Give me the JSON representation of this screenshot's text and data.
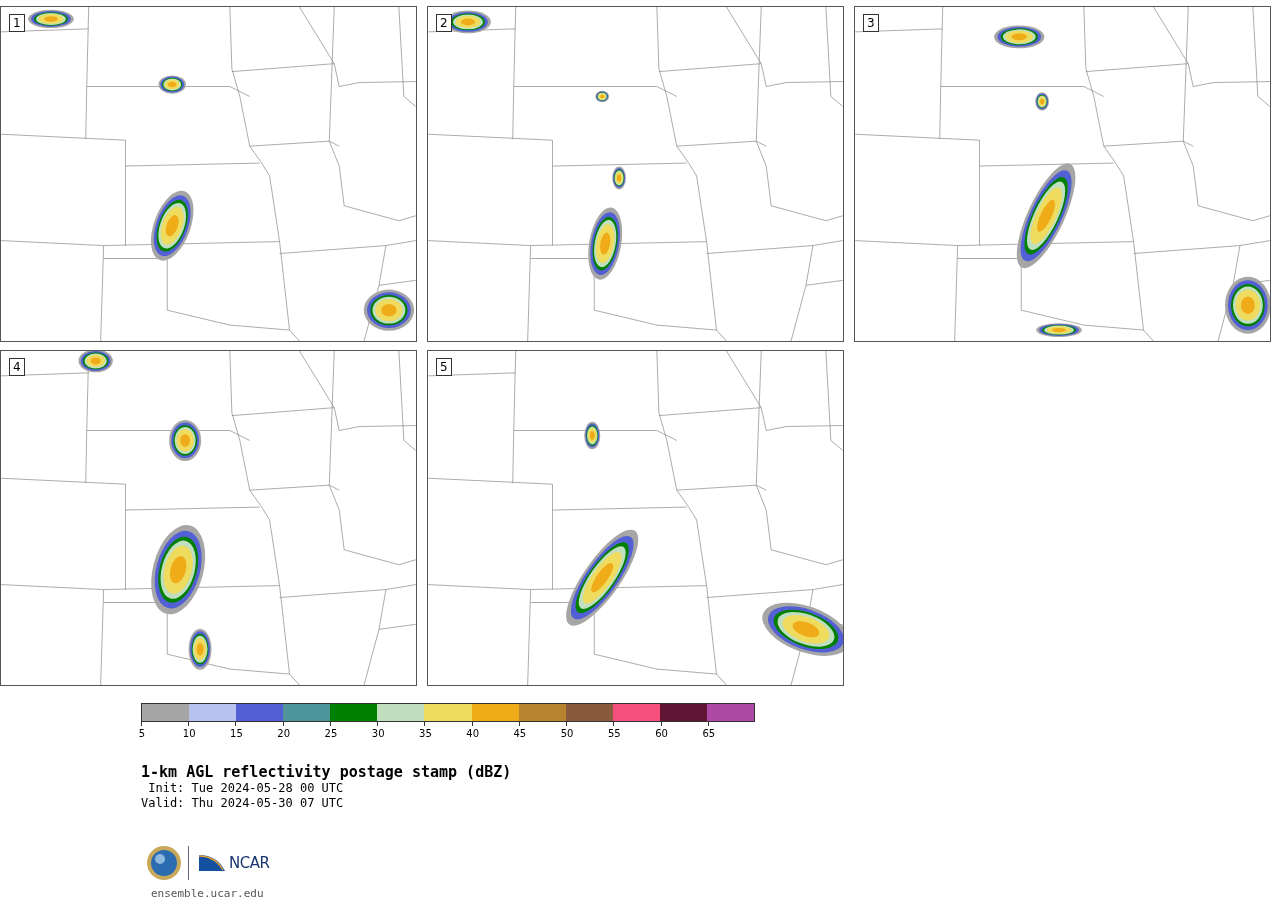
{
  "panels": [
    {
      "label": "1"
    },
    {
      "label": "2"
    },
    {
      "label": "3"
    },
    {
      "label": "4"
    },
    {
      "label": "5"
    }
  ],
  "colorbar": {
    "segments": [
      {
        "color": "#a6a6a6"
      },
      {
        "color": "#b8c2ee"
      },
      {
        "color": "#535fd4"
      },
      {
        "color": "#4e949b"
      },
      {
        "color": "#008000"
      },
      {
        "color": "#bfdfbf"
      },
      {
        "color": "#efdb5e"
      },
      {
        "color": "#efac18"
      },
      {
        "color": "#b8822f"
      },
      {
        "color": "#8a5a3e"
      },
      {
        "color": "#f54f7e"
      },
      {
        "color": "#601534"
      },
      {
        "color": "#ac4aa3"
      }
    ],
    "ticks": [
      "5",
      "10",
      "15",
      "20",
      "25",
      "30",
      "35",
      "40",
      "45",
      "50",
      "55",
      "60",
      "65"
    ]
  },
  "title": "1-km AGL reflectivity postage stamp (dBZ)",
  "init": " Init: Tue 2024-05-28 00 UTC",
  "valid": "Valid: Thu 2024-05-30 07 UTC",
  "logo": {
    "text": "NCAR"
  },
  "url": "ensemble.ucar.edu"
}
